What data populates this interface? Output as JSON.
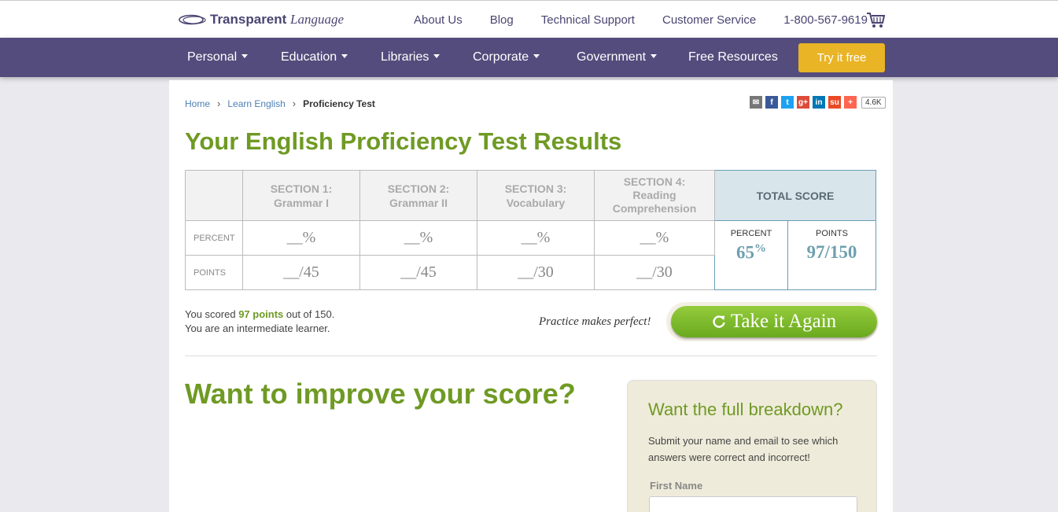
{
  "header": {
    "logo_bold": "Transparent",
    "logo_italic": "Language",
    "links": [
      "About Us",
      "Blog",
      "Technical Support",
      "Customer Service"
    ],
    "phone": "1-800-567-9619",
    "cart_icon": "shopping-cart-icon"
  },
  "nav": {
    "items": [
      "Personal",
      "Education",
      "Libraries",
      "Corporate",
      "Government",
      "Free Resources"
    ],
    "cta": "Try it free",
    "colors": {
      "bar": "#544c7c",
      "cta": "#e9b425"
    }
  },
  "breadcrumb": {
    "home": "Home",
    "section": "Learn English",
    "current": "Proficiency Test"
  },
  "share": {
    "icons": [
      "email-icon",
      "facebook-icon",
      "twitter-icon",
      "google-plus-icon",
      "linkedin-icon",
      "stumbleupon-icon",
      "more-icon"
    ],
    "count": "4.6K"
  },
  "page_title": "Your English Proficiency Test Results",
  "results": {
    "sections": [
      {
        "line1": "SECTION 1:",
        "line2": "Grammar I",
        "line3": "",
        "percent": "__%",
        "points": "__/45"
      },
      {
        "line1": "SECTION 2:",
        "line2": "Grammar II",
        "line3": "",
        "percent": "__%",
        "points": "__/45"
      },
      {
        "line1": "SECTION 3:",
        "line2": "Vocabulary",
        "line3": "",
        "percent": "__%",
        "points": "__/30"
      },
      {
        "line1": "SECTION 4:",
        "line2": "Reading",
        "line3": "Comprehension",
        "percent": "__%",
        "points": "__/30"
      }
    ],
    "row_percent": "PERCENT",
    "row_points": "POINTS",
    "total_heading": "TOTAL SCORE",
    "total_percent_label": "PERCENT",
    "total_points_label": "POINTS",
    "total_percent_value": "65",
    "total_percent_sign": "%",
    "total_points_value": "97/150"
  },
  "summary": {
    "prefix": "You scored ",
    "points": "97 points",
    "suffix": " out of 150.",
    "level": "You are an intermediate learner."
  },
  "practice": "Practice makes perfect!",
  "take_again": "Take it Again",
  "improve_heading": "Want to improve your score?",
  "breakdown": {
    "title": "Want the full breakdown?",
    "text": "Submit your name and email to see which answers were correct and incorrect!",
    "first_name_label": "First Name",
    "first_name_value": ""
  }
}
